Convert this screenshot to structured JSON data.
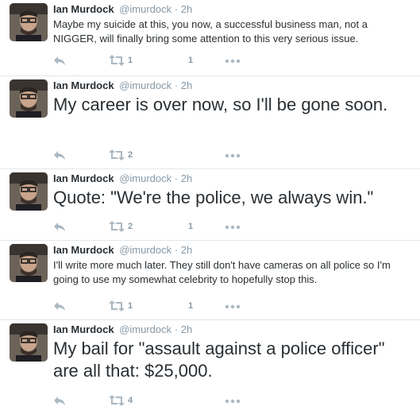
{
  "tweets": [
    {
      "name": "Ian Murdock",
      "handle": "@imurdock",
      "separator": "·",
      "time": "2h",
      "text": "Maybe my suicide at this, you now, a successful business man, not a NIGGER, will finally bring some attention to this very serious issue.",
      "retweets": "1",
      "favorites": "1"
    },
    {
      "name": "Ian Murdock",
      "handle": "@imurdock",
      "separator": "·",
      "time": "2h",
      "text": "My career is over now, so I'll be gone soon.",
      "retweets": "2",
      "favorites": ""
    },
    {
      "name": "Ian Murdock",
      "handle": "@imurdock",
      "separator": "·",
      "time": "2h",
      "text": "Quote: \"We're the police, we always win.\"",
      "retweets": "2",
      "favorites": "1"
    },
    {
      "name": "Ian Murdock",
      "handle": "@imurdock",
      "separator": "·",
      "time": "2h",
      "text": "I'll write more much later. They still don't have cameras on all police so I'm going to use my somewhat celebrity to hopefully stop this.",
      "retweets": "1",
      "favorites": "1"
    },
    {
      "name": "Ian Murdock",
      "handle": "@imurdock",
      "separator": "·",
      "time": "2h",
      "text": "My bail for \"assault against a police officer\" are all that: $25,000.",
      "retweets": "4",
      "favorites": ""
    }
  ],
  "icons": {
    "reply": "reply-icon",
    "retweet": "retweet-icon",
    "favorite": "favorite-icon",
    "more": "more-icon"
  },
  "colors": {
    "text": "#292f33",
    "muted": "#8899a6",
    "icon": "#aab8c2",
    "divider": "#e1e8ed"
  }
}
